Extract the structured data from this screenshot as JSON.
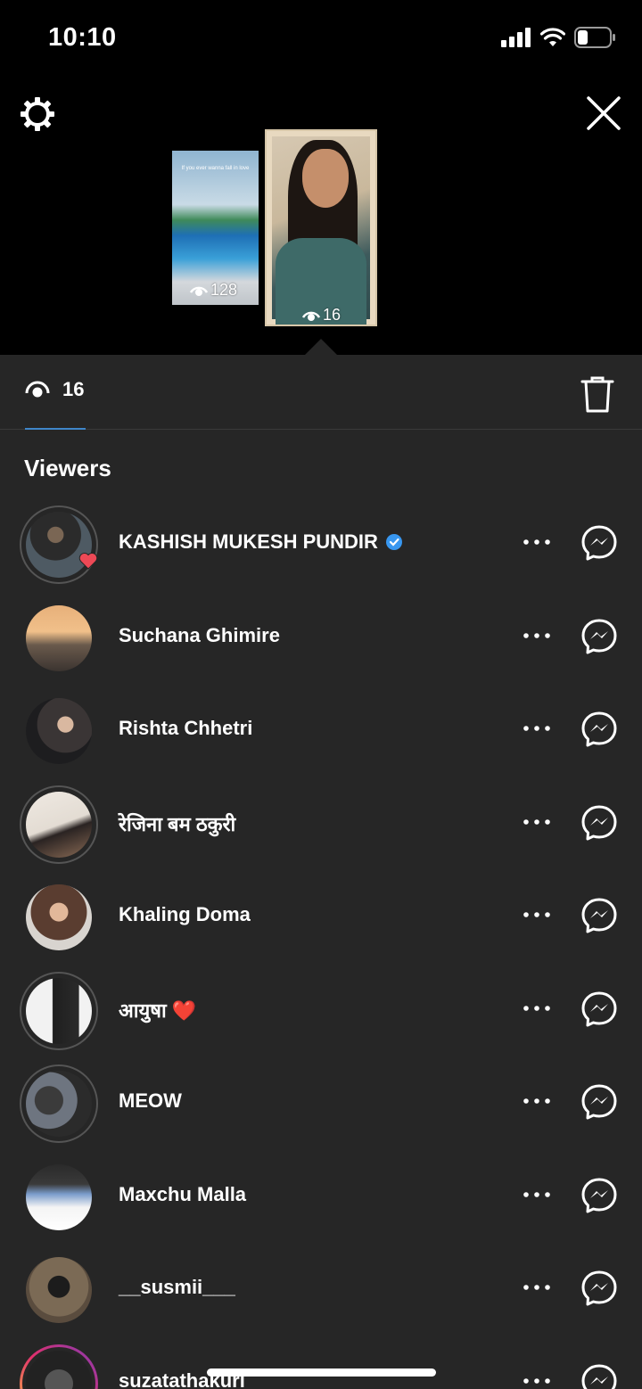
{
  "status_bar": {
    "time": "10:10"
  },
  "stories": [
    {
      "views": "128",
      "caption": "If you ever wanna fall in love"
    },
    {
      "views": "16"
    }
  ],
  "tab": {
    "view_count": "16"
  },
  "section_title": "Viewers",
  "viewers": [
    {
      "name": "KASHISH MUKESH PUNDIR",
      "verified": true,
      "liked": true,
      "ring": "seen"
    },
    {
      "name": "Suchana Ghimire",
      "ring": "none"
    },
    {
      "name": "Rishta Chhetri",
      "ring": "none"
    },
    {
      "name": "रेजिना बम ठकुरी",
      "ring": "seen"
    },
    {
      "name": "Khaling Doma",
      "ring": "none"
    },
    {
      "name": "आयुषा ❤️",
      "ring": "seen"
    },
    {
      "name": "MEOW",
      "ring": "seen"
    },
    {
      "name": "Maxchu Malla",
      "ring": "none"
    },
    {
      "name": "__susmii___",
      "ring": "none"
    },
    {
      "name": "suzatathakuri",
      "ring": "story"
    }
  ],
  "colors": {
    "sheet_bg": "#262626",
    "accent_blue": "#3f86c9",
    "verified_blue": "#3897f0",
    "like_red": "#ed4956"
  }
}
